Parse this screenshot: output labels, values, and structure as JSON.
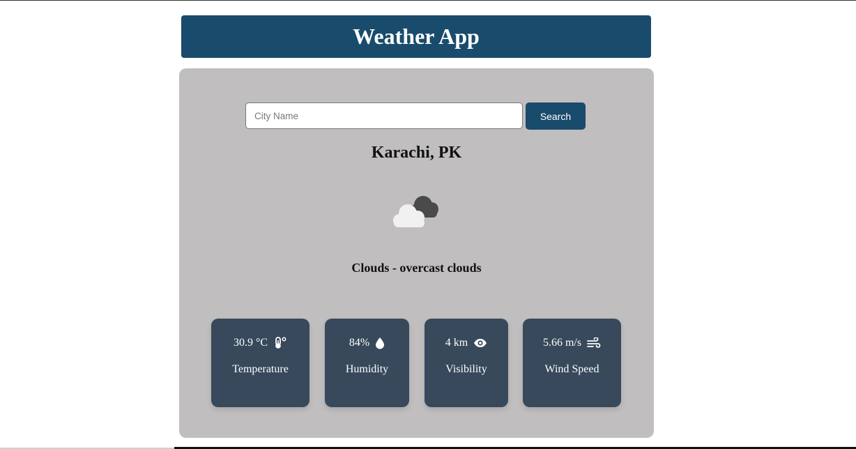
{
  "app": {
    "title": "Weather App"
  },
  "search": {
    "placeholder": "City Name",
    "value": "",
    "button_label": "Search"
  },
  "location": {
    "name": "Karachi, PK"
  },
  "weather": {
    "icon": "overcast-clouds-icon",
    "description": "Clouds - overcast clouds"
  },
  "stats": [
    {
      "value": "30.9 °C",
      "label": "Temperature",
      "icon": "thermometer-celsius-icon"
    },
    {
      "value": "84%",
      "label": "Humidity",
      "icon": "water-drop-icon"
    },
    {
      "value": "4 km",
      "label": "Visibility",
      "icon": "eye-icon"
    },
    {
      "value": "5.66 m/s",
      "label": "Wind Speed",
      "icon": "wind-icon"
    }
  ],
  "colors": {
    "header_bg": "#194b6c",
    "card_bg": "#c0bebf",
    "stat_bg": "#37495b",
    "button_bg": "#194b6c"
  }
}
